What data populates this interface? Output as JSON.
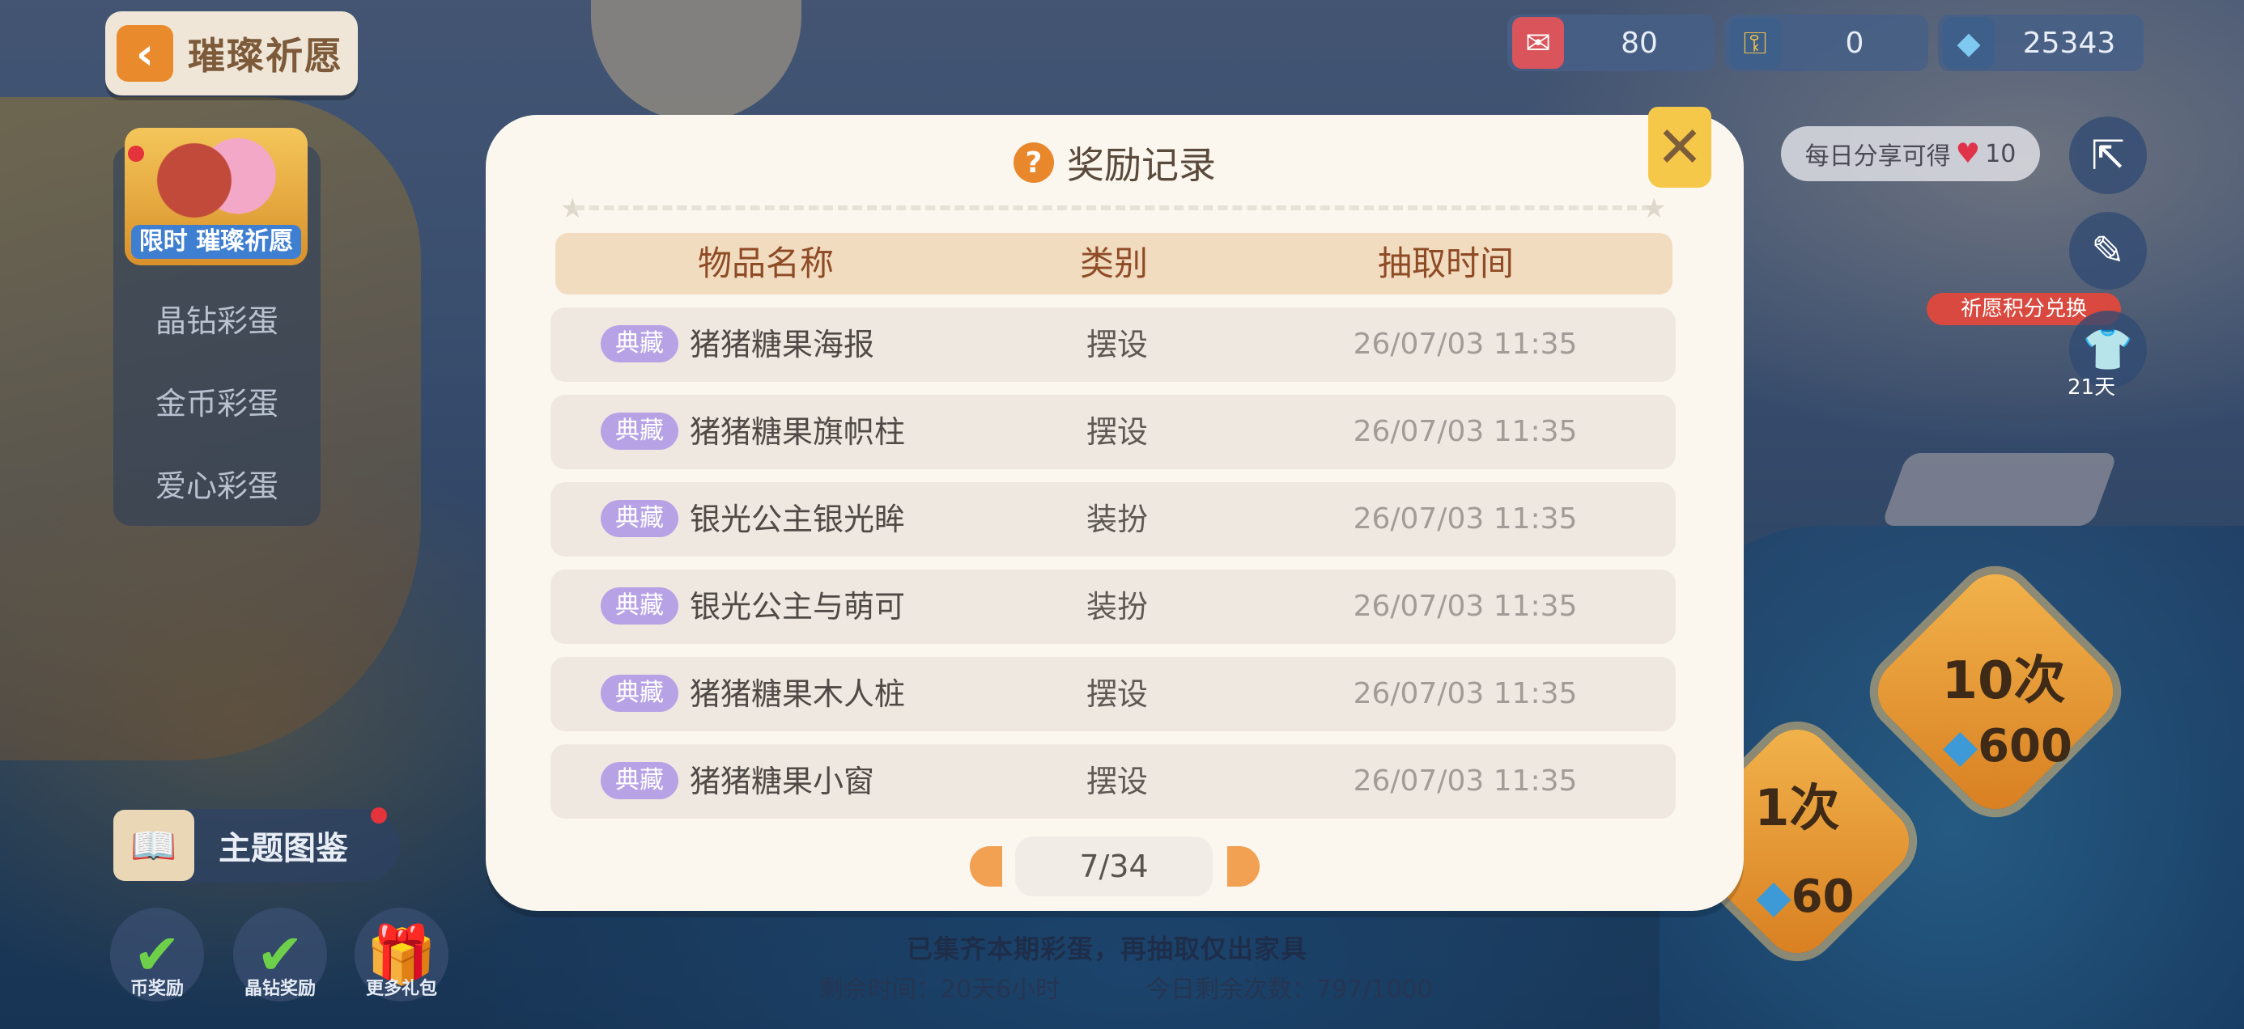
{
  "header": {
    "title": "璀璨祈愿",
    "back_icon": "arrow-left-icon"
  },
  "currencies": [
    {
      "icon": "ticket-icon",
      "value": "80"
    },
    {
      "icon": "key-icon",
      "value": "0"
    },
    {
      "icon": "diamond-icon",
      "value": "25343"
    }
  ],
  "side_menu": {
    "badge_label": "限时 璀璨祈愿",
    "items": [
      "晶钻彩蛋",
      "金币彩蛋",
      "爱心彩蛋"
    ]
  },
  "bottom_left": {
    "theme_label": "主题图鉴",
    "buttons": [
      {
        "label": "币奖励"
      },
      {
        "label": "晶钻奖励"
      },
      {
        "label": "更多礼包"
      }
    ]
  },
  "bottom": {
    "notice": "已集齐本期彩蛋，再抽取仅出家具",
    "remaining_time": "剩余时间：20天6小时",
    "remaining_count": "今日剩余次数：797/1000"
  },
  "right": {
    "share_text": "每日分享可得",
    "share_reward": "10",
    "exchange_label": "祈愿积分兑换",
    "days_left": "21天",
    "draw_once": {
      "label": "1次",
      "cost": "60"
    },
    "draw_ten": {
      "label": "10次",
      "cost": "600"
    }
  },
  "modal": {
    "title": "奖励记录",
    "columns": [
      "物品名称",
      "类别",
      "抽取时间"
    ],
    "rows": [
      {
        "tag": "典藏",
        "name": "猪猪糖果海报",
        "category": "摆设",
        "time": "26/07/03  11:35"
      },
      {
        "tag": "典藏",
        "name": "猪猪糖果旗帜柱",
        "category": "摆设",
        "time": "26/07/03  11:35"
      },
      {
        "tag": "典藏",
        "name": "银光公主银光眸",
        "category": "装扮",
        "time": "26/07/03  11:35"
      },
      {
        "tag": "典藏",
        "name": "银光公主与萌可",
        "category": "装扮",
        "time": "26/07/03  11:35"
      },
      {
        "tag": "典藏",
        "name": "猪猪糖果木人桩",
        "category": "摆设",
        "time": "26/07/03  11:35"
      },
      {
        "tag": "典藏",
        "name": "猪猪糖果小窗",
        "category": "摆设",
        "time": "26/07/03  11:35"
      }
    ],
    "pagination": "7/34"
  },
  "colors": {
    "accent": "#e8872b",
    "header_bg": "#f1dcc0",
    "header_text": "#8f4b26",
    "tag_bg": "#b7a2e6"
  }
}
